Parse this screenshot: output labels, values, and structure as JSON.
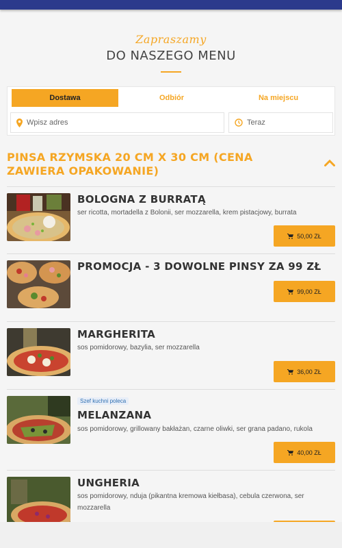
{
  "hero": {
    "script_text": "Zapraszamy",
    "title": "DO NASZEGO MENU"
  },
  "order_tabs": [
    {
      "label": "Dostawa",
      "active": true
    },
    {
      "label": "Odbiór",
      "active": false
    },
    {
      "label": "Na miejscu",
      "active": false
    }
  ],
  "address": {
    "placeholder": "Wpisz adres",
    "icon": "map-pin-icon"
  },
  "time": {
    "value": "Teraz",
    "icon": "clock-icon"
  },
  "section": {
    "title": "PINSA RZYMSKA 20 CM X 30 CM (CENA ZAWIERA OPAKOWANIE)",
    "collapse_icon": "chevron-up-icon"
  },
  "items": [
    {
      "name": "BOLOGNA Z BURRATĄ",
      "description": "ser ricotta, mortadella z Bolonii, ser mozzarella, krem pistacjowy, burrata",
      "price": "50,00 ZŁ",
      "badge": ""
    },
    {
      "name": "PROMOCJA - 3 DOWOLNE PINSY ZA 99 ZŁ",
      "description": "",
      "price": "99,00 ZŁ",
      "badge": ""
    },
    {
      "name": "MARGHERITA",
      "description": "sos pomidorowy, bazylia, ser mozzarella",
      "price": "36,00 ZŁ",
      "badge": ""
    },
    {
      "name": "MELANZANA",
      "description": "sos pomidorowy, grillowany bakłażan, czarne oliwki, ser grana padano, rukola",
      "price": "40,00 ZŁ",
      "badge": "Szef kuchni poleca"
    },
    {
      "name": "UNGHERIA",
      "description": "sos pomidorowy, nduja (pikantna kremowa kiełbasa), cebula czerwona, ser mozzarella",
      "price": "",
      "badge": ""
    }
  ],
  "colors": {
    "accent": "#f5a623",
    "topbar": "#2b3a8c",
    "badge_text": "#2f6fb0"
  }
}
